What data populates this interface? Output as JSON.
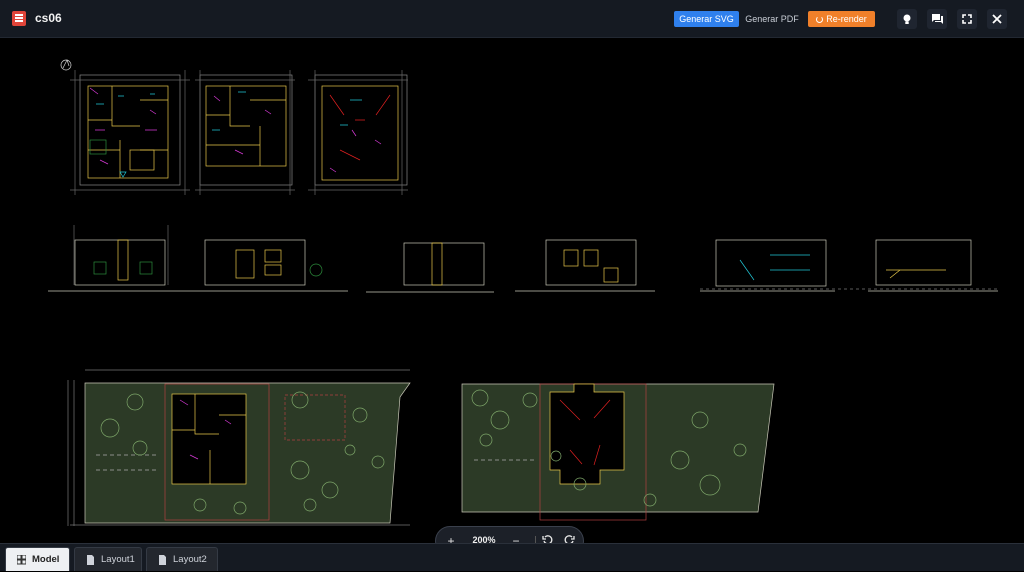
{
  "header": {
    "title": "cs06",
    "generate_svg": "Generar SVG",
    "generate_pdf": "Generar PDF",
    "rerender": "Re-render",
    "icons": [
      "lightbulb-icon",
      "chat-icon",
      "fullscreen-icon",
      "close-icon"
    ]
  },
  "zoom": {
    "zoom_in": "+",
    "level": "200%",
    "zoom_out": "−"
  },
  "tabs": [
    {
      "label": "Model",
      "active": true
    },
    {
      "label": "Layout1",
      "active": false
    },
    {
      "label": "Layout2",
      "active": false
    }
  ],
  "colors": {
    "accent_blue": "#2f80ed",
    "accent_orange": "#f0802a",
    "cad_line": "#c9c8b8",
    "cad_wall": "#e8c84a",
    "cad_dim": "#d83ad8",
    "cad_green": "#2c3a26",
    "cad_red": "#e02020"
  }
}
